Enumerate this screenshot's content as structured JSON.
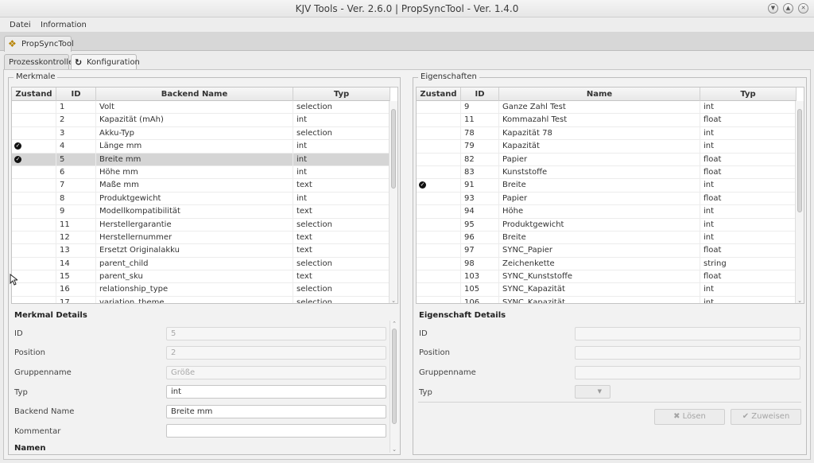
{
  "window": {
    "title": "KJV Tools - Ver. 2.6.0 | PropSyncTool - Ver. 1.4.0",
    "controls": [
      "minimize",
      "maximize",
      "close"
    ]
  },
  "menu": {
    "datei": "Datei",
    "information": "Information"
  },
  "app_tab": {
    "label": "PropSyncTool",
    "icon": "plugin-icon"
  },
  "subtabs": {
    "prozesskontrolle": "Prozesskontrolle",
    "konfiguration": "Konfiguration"
  },
  "merkmale": {
    "title": "Merkmale",
    "headers": {
      "zustand": "Zustand",
      "id": "ID",
      "name": "Backend Name",
      "typ": "Typ"
    },
    "rows": [
      {
        "check": false,
        "id": "1",
        "name": "Volt",
        "typ": "selection"
      },
      {
        "check": false,
        "id": "2",
        "name": "Kapazität (mAh)",
        "typ": "int"
      },
      {
        "check": false,
        "id": "3",
        "name": "Akku-Typ",
        "typ": "selection"
      },
      {
        "check": true,
        "id": "4",
        "name": "Länge mm",
        "typ": "int"
      },
      {
        "check": true,
        "id": "5",
        "name": "Breite mm",
        "typ": "int",
        "selected": true
      },
      {
        "check": false,
        "id": "6",
        "name": "Höhe mm",
        "typ": "int"
      },
      {
        "check": false,
        "id": "7",
        "name": "Maße mm",
        "typ": "text"
      },
      {
        "check": false,
        "id": "8",
        "name": "Produktgewicht",
        "typ": "int"
      },
      {
        "check": false,
        "id": "9",
        "name": "Modellkompatibilität",
        "typ": "text"
      },
      {
        "check": false,
        "id": "11",
        "name": "Herstellergarantie",
        "typ": "selection"
      },
      {
        "check": false,
        "id": "12",
        "name": "Herstellernummer",
        "typ": "text"
      },
      {
        "check": false,
        "id": "13",
        "name": "Ersetzt Originalakku",
        "typ": "text"
      },
      {
        "check": false,
        "id": "14",
        "name": "parent_child",
        "typ": "selection"
      },
      {
        "check": false,
        "id": "15",
        "name": "parent_sku",
        "typ": "text"
      },
      {
        "check": false,
        "id": "16",
        "name": "relationship_type",
        "typ": "selection"
      },
      {
        "check": false,
        "id": "17",
        "name": "variation_theme",
        "typ": "selection"
      }
    ]
  },
  "merkmal_details": {
    "title": "Merkmal Details",
    "id_label": "ID",
    "id_value": "5",
    "position_label": "Position",
    "position_value": "2",
    "gruppenname_label": "Gruppenname",
    "gruppenname_value": "Größe",
    "typ_label": "Typ",
    "typ_value": "int",
    "backend_label": "Backend Name",
    "backend_value": "Breite mm",
    "kommentar_label": "Kommentar",
    "kommentar_value": "",
    "namen_label": "Namen"
  },
  "eigenschaften": {
    "title": "Eigenschaften",
    "headers": {
      "zustand": "Zustand",
      "id": "ID",
      "name": "Name",
      "typ": "Typ"
    },
    "rows": [
      {
        "check": false,
        "id": "9",
        "name": "Ganze Zahl Test",
        "typ": "int"
      },
      {
        "check": false,
        "id": "11",
        "name": "Kommazahl Test",
        "typ": "float"
      },
      {
        "check": false,
        "id": "78",
        "name": "Kapazität 78",
        "typ": "int"
      },
      {
        "check": false,
        "id": "79",
        "name": "Kapazität",
        "typ": "int"
      },
      {
        "check": false,
        "id": "82",
        "name": "Papier",
        "typ": "float"
      },
      {
        "check": false,
        "id": "83",
        "name": "Kunststoffe",
        "typ": "float"
      },
      {
        "check": true,
        "id": "91",
        "name": "Breite",
        "typ": "int"
      },
      {
        "check": false,
        "id": "93",
        "name": "Papier",
        "typ": "float"
      },
      {
        "check": false,
        "id": "94",
        "name": "Höhe",
        "typ": "int"
      },
      {
        "check": false,
        "id": "95",
        "name": "Produktgewicht",
        "typ": "int"
      },
      {
        "check": false,
        "id": "96",
        "name": "Breite",
        "typ": "int"
      },
      {
        "check": false,
        "id": "97",
        "name": "SYNC_Papier",
        "typ": "float"
      },
      {
        "check": false,
        "id": "98",
        "name": "Zeichenkette",
        "typ": "string"
      },
      {
        "check": false,
        "id": "103",
        "name": "SYNC_Kunststoffe",
        "typ": "float"
      },
      {
        "check": false,
        "id": "105",
        "name": "SYNC_Kapazität",
        "typ": "int"
      },
      {
        "check": false,
        "id": "106",
        "name": "SYNC_Kapazität",
        "typ": "int"
      }
    ]
  },
  "eigenschaft_details": {
    "title": "Eigenschaft Details",
    "id_label": "ID",
    "position_label": "Position",
    "gruppenname_label": "Gruppenname",
    "typ_label": "Typ",
    "loesen_label": "Lösen",
    "zuweisen_label": "Zuweisen"
  }
}
